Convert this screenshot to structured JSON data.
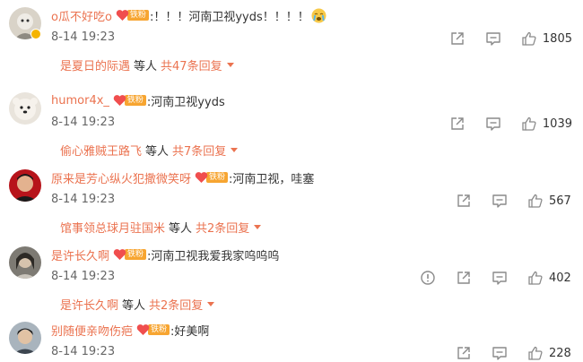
{
  "comments": [
    {
      "username": "o瓜不好吃o",
      "fan_label": "铁粉",
      "text": ":！！！河南卫视yyds！！！！",
      "has_emoji": true,
      "time": "8-14 19:23",
      "likes": "1805",
      "reply_user": "是夏日的际遇",
      "reply_etc": "等人",
      "reply_count": "共47条回复",
      "action_icons": [
        "reply-icon",
        "comment-icon",
        "thumbs-up-icon"
      ]
    },
    {
      "username": "humor4x_",
      "fan_label": "铁粉",
      "text": ":河南卫视yyds",
      "has_emoji": false,
      "time": "8-14 19:23",
      "likes": "1039",
      "reply_user": "偷心雅贼王路飞",
      "reply_etc": "等人",
      "reply_count": "共7条回复",
      "action_icons": [
        "reply-icon",
        "comment-icon",
        "thumbs-up-icon"
      ]
    },
    {
      "username": "原来是芳心纵火犯撒微笑呀",
      "fan_label": "铁粉",
      "text": ":河南卫视，哇塞",
      "has_emoji": false,
      "time": "8-14 19:23",
      "likes": "567",
      "reply_user": "馆事领总球月驻国米",
      "reply_etc": "等人",
      "reply_count": "共2条回复",
      "action_icons": [
        "reply-icon",
        "comment-icon",
        "thumbs-up-icon"
      ]
    },
    {
      "username": "是许长久啊",
      "fan_label": "铁粉",
      "text": ":河南卫视我爱我家呜呜呜",
      "has_emoji": false,
      "time": "8-14 19:23",
      "likes": "402",
      "reply_user": "是许长久啊",
      "reply_etc": "等人",
      "reply_count": "共2条回复",
      "action_icons": [
        "report-icon",
        "reply-icon",
        "comment-icon",
        "thumbs-up-icon"
      ]
    },
    {
      "username": "别随便亲吻伤疤",
      "fan_label": "铁粉",
      "text": ":好美啊",
      "has_emoji": false,
      "time": "8-14 19:23",
      "likes": "228",
      "reply_user": "",
      "reply_etc": "",
      "reply_count": "",
      "action_icons": [
        "reply-icon",
        "comment-icon",
        "thumbs-up-icon"
      ]
    }
  ],
  "colors": {
    "name": "#eb7350",
    "text": "#333333",
    "time": "#666666",
    "fan_badge": "#f7a531",
    "verified": "#f5b400",
    "icon": "#8a8a8a"
  }
}
